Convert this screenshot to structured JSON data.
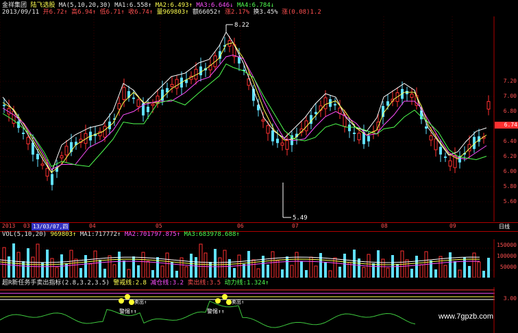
{
  "header": {
    "app_name": "金祥集团",
    "stock_name": "陆飞选股",
    "ma_label": "MA(5,10,20,30)",
    "ma1": "MA1:6.558↑",
    "ma2": "MA2:6.493↑",
    "ma3": "MA3:6.646↓",
    "ma4": "MA4:6.784↓"
  },
  "quote": {
    "date": "2013/09/11",
    "open": "开6.72↑",
    "high": "高6.94↑",
    "low": "低6.71↑",
    "close": "收6.74↑",
    "volume": "量969803↑",
    "amount": "额66052↑",
    "change": "涨2.17%",
    "turnover": "换3.45%",
    "rise": "涨(0.08)1.2"
  },
  "price_axis": {
    "ticks": [
      "7.20",
      "7.00",
      "6.80",
      "6.60",
      "6.40",
      "6.20",
      "6.00",
      "5.80",
      "5.60"
    ],
    "current_price": "6.74",
    "peak_label": "8.22",
    "low_label": "5.49"
  },
  "date_bar": {
    "year": "2013",
    "month_03": "03",
    "cursor_date": "13/03/07,四",
    "months": [
      "04",
      "05",
      "06",
      "07",
      "08",
      "09"
    ],
    "period_button": "日线"
  },
  "volume": {
    "label": "VOL(5,10,20)",
    "value": "969803↑",
    "ma1": "MA1:717772↑",
    "ma2": "MA2:701797.875↑",
    "ma3": "MA3:683978.688↑",
    "ticks": [
      "150000",
      "100000",
      "50000"
    ]
  },
  "indicator": {
    "name": "超R新任务手卖出指标(2.8,3.2,3.5)",
    "warn": "警戒线:2.8",
    "reduce": "减仓线:3.2",
    "sell": "卖出线:3.5",
    "power": "动力线:1.324↑",
    "axis_tick": "3.00",
    "tag1": "警惕↑↑",
    "tag2": "警惕↑↑",
    "tag_small1": "卖出↑",
    "tag_small2": "卖出↑"
  },
  "watermark": "www.7gpzb.com",
  "colors": {
    "up": "#ff3030",
    "down": "#50e0ff",
    "ma1": "#ffffff",
    "ma2": "#ffff50",
    "ma3": "#ff50ff",
    "ma4": "#50ff50",
    "power": "#50c850"
  }
}
